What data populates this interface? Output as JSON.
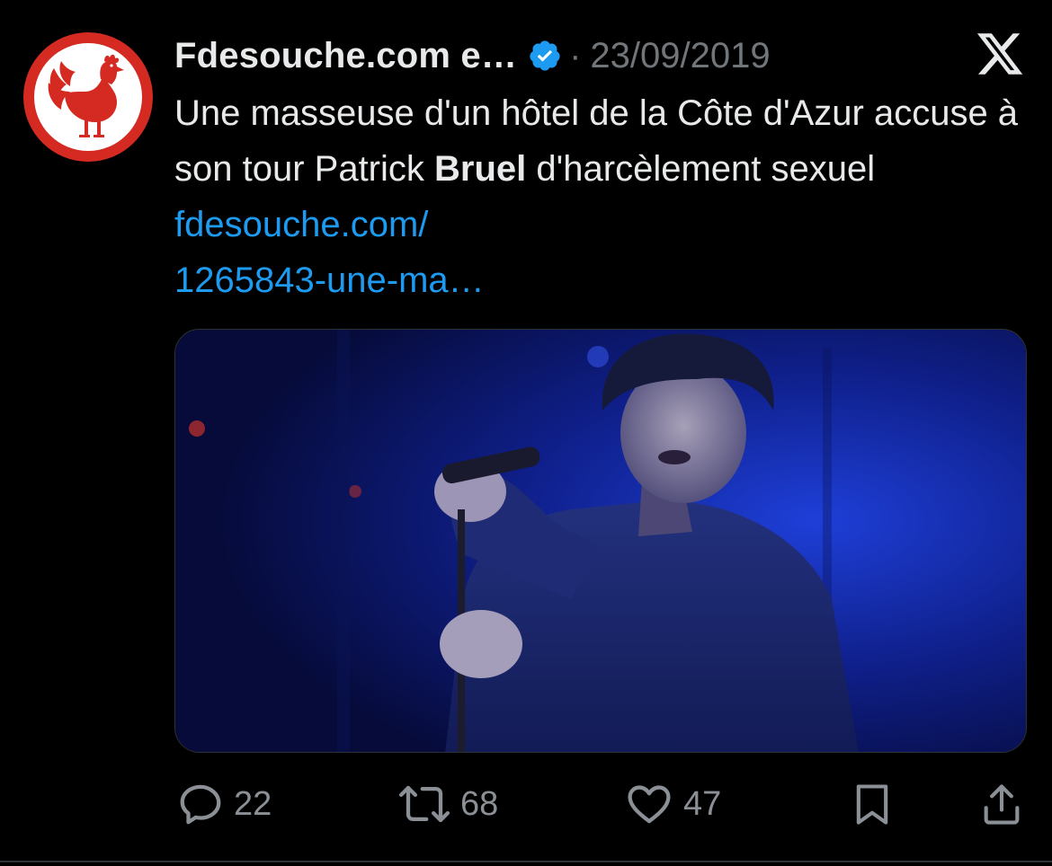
{
  "tweet": {
    "author_name": "Fdesouche.com e…",
    "separator": "·",
    "date": "23/09/2019",
    "text_part1": "Une masseuse d'un hôtel de la Côte d'Azur accuse à son tour Patrick ",
    "text_bold": "Bruel",
    "text_part2": " d'harcèlement sexuel ",
    "link_line1": "fdesouche.com/",
    "link_line2": "1265843-une-ma…"
  },
  "icons": {
    "avatar": "rooster-logo",
    "verified": "verified-badge-icon",
    "platform": "x-logo-icon",
    "reply": "reply-icon",
    "retweet": "retweet-icon",
    "like": "heart-icon",
    "bookmark": "bookmark-icon",
    "share": "share-icon"
  },
  "actions": {
    "reply_count": "22",
    "retweet_count": "68",
    "like_count": "47"
  },
  "colors": {
    "background": "#000000",
    "text": "#e7e9ea",
    "muted": "#71767b",
    "link": "#1d9bf0",
    "avatar_red": "#d42a22"
  }
}
